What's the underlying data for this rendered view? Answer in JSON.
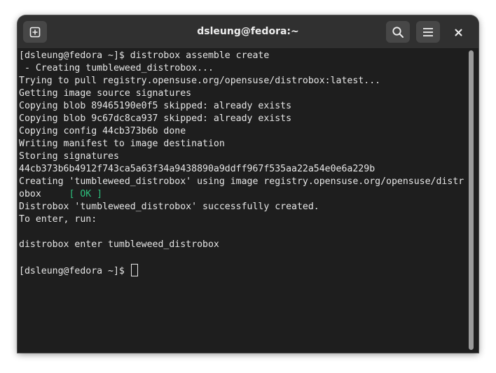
{
  "window": {
    "title": "dsleung@fedora:~"
  },
  "headerbar": {
    "new_tab_icon": "new-tab-icon",
    "search_icon": "search-icon",
    "menu_icon": "hamburger-menu-icon",
    "close_icon": "close-icon"
  },
  "terminal": {
    "lines": [
      "[dsleung@fedora ~]$ distrobox assemble create",
      " - Creating tumbleweed_distrobox...",
      "Trying to pull registry.opensuse.org/opensuse/distrobox:latest...",
      "Getting image source signatures",
      "Copying blob 89465190e0f5 skipped: already exists",
      "Copying blob 9c67dc8ca937 skipped: already exists",
      "Copying config 44cb373b6b done",
      "Writing manifest to image destination",
      "Storing signatures",
      "44cb373b6b4912f743ca5a63f34a9438890a9ddff967f535aa22a54e0e6a229b",
      "Creating 'tumbleweed_distrobox' using image registry.opensuse.org/opensuse/distr",
      "obox     ",
      "Distrobox 'tumbleweed_distrobox' successfully created.",
      "To enter, run:",
      "",
      "distrobox enter tumbleweed_distrobox",
      "",
      "[dsleung@fedora ~]$ "
    ],
    "ok_status": "[ OK ]",
    "colors": {
      "background": "#1e1e1e",
      "foreground": "#e6e6e6",
      "ok_green": "#2ec27e"
    }
  }
}
